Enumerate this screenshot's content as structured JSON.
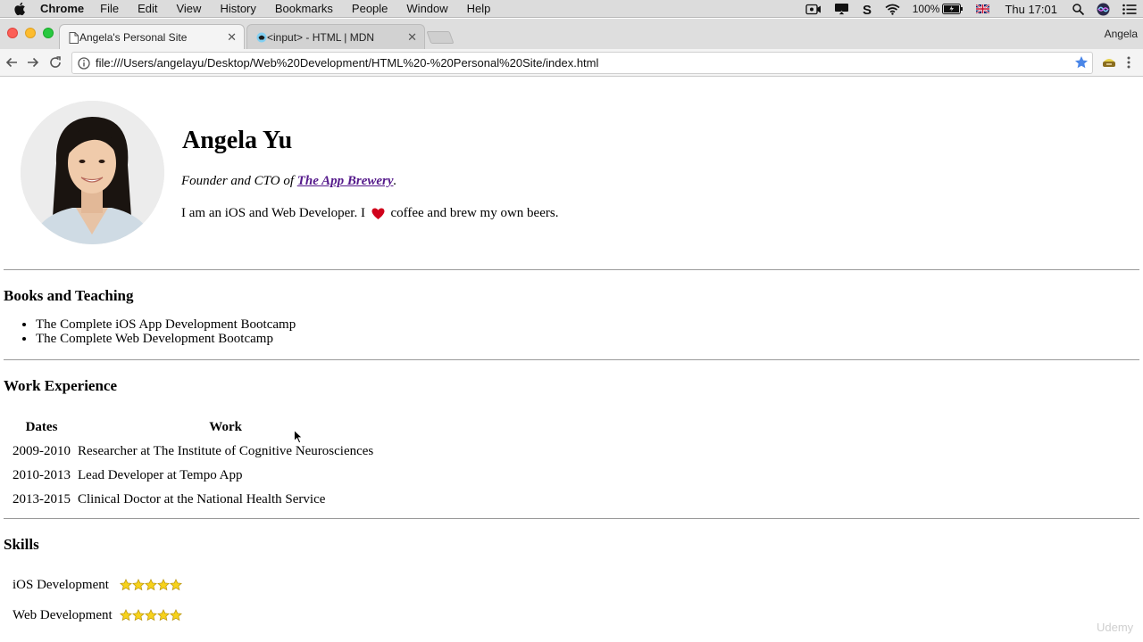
{
  "menubar": {
    "app_name": "Chrome",
    "items": [
      "File",
      "Edit",
      "View",
      "History",
      "Bookmarks",
      "People",
      "Window",
      "Help"
    ],
    "status": {
      "battery_percent": "100%",
      "clock": "Thu 17:01"
    },
    "icons": [
      "apple-icon",
      "screen-record-icon",
      "airplay-icon",
      "skype-icon",
      "wifi-icon",
      "battery-icon",
      "uk-flag-icon",
      "spotlight-icon",
      "siri-icon",
      "notification-center-icon"
    ]
  },
  "tabs": [
    {
      "title": "Angela's Personal Site",
      "active": true,
      "icon": "page-icon"
    },
    {
      "title": "<input> - HTML | MDN",
      "active": false,
      "icon": "mdn-icon"
    }
  ],
  "profile_name": "Angela",
  "toolbar": {
    "url": "file:///Users/angelayu/Desktop/Web%20Development/HTML%20-%20Personal%20Site/index.html",
    "icons": [
      "back-arrow-icon",
      "forward-arrow-icon",
      "reload-icon",
      "info-icon",
      "bookmark-star-icon",
      "extension-icon",
      "menu-dots-icon"
    ]
  },
  "profile": {
    "name": "Angela Yu",
    "tagline_prefix": "Founder and CTO of ",
    "tagline_link": "The App Brewery",
    "tagline_suffix": ".",
    "bio_before": "I am an iOS and Web Developer. I ",
    "bio_after": " coffee and brew my own beers."
  },
  "sections": {
    "books": {
      "heading": "Books and Teaching",
      "items": [
        "The Complete iOS App Development Bootcamp",
        "The Complete Web Development Bootcamp"
      ]
    },
    "work": {
      "heading": "Work Experience",
      "columns": [
        "Dates",
        "Work"
      ],
      "rows": [
        {
          "dates": "2009-2010",
          "work": "Researcher at The Institute of Cognitive Neurosciences"
        },
        {
          "dates": "2010-2013",
          "work": "Lead Developer at Tempo App"
        },
        {
          "dates": "2013-2015",
          "work": "Clinical Doctor at the National Health Service"
        }
      ]
    },
    "skills": {
      "heading": "Skills",
      "rows": [
        {
          "skill": "iOS Development",
          "stars": 5
        },
        {
          "skill": "Web Development",
          "stars": 5
        }
      ]
    }
  },
  "watermark": "Udemy",
  "colors": {
    "link_visited": "#551a8b",
    "star_fill": "#f7d21b",
    "heart": "#d0021b"
  }
}
